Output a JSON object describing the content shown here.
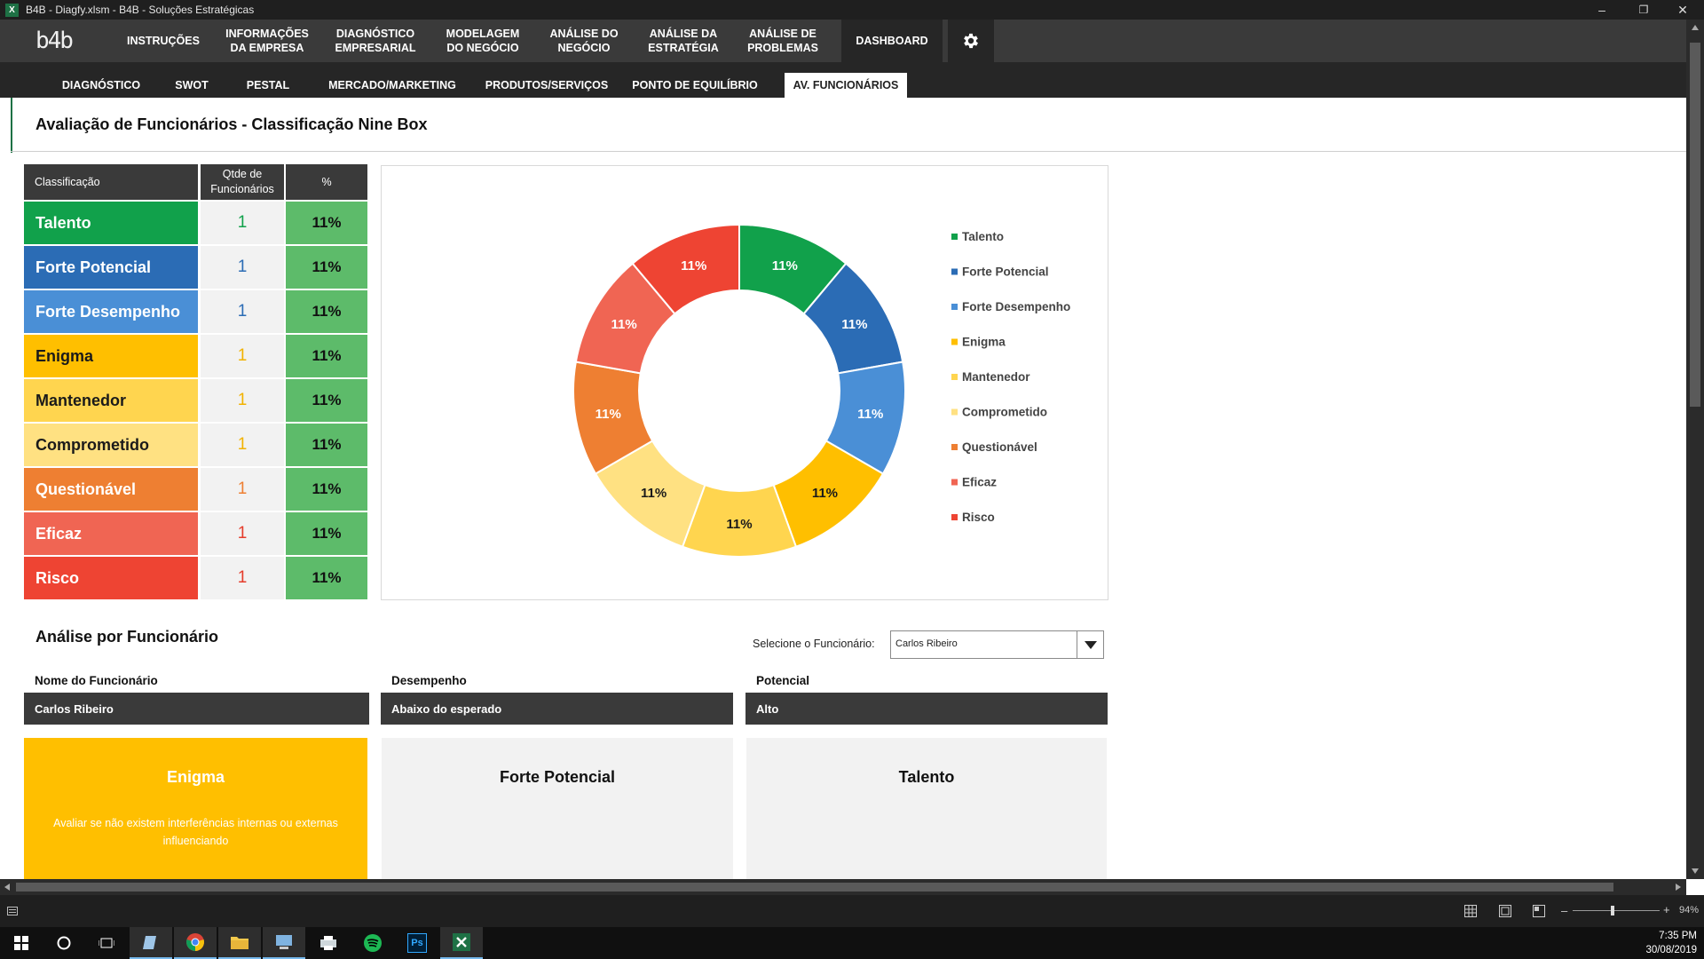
{
  "window": {
    "title": "B4B - Diagfy.xlsm - B4B - Soluções Estratégicas",
    "app_icon": "X"
  },
  "nav": {
    "logo": "b4b",
    "items": [
      {
        "label": "INSTRUÇÕES"
      },
      {
        "label": "INFORMAÇÕES\nDA EMPRESA"
      },
      {
        "label": "DIAGNÓSTICO\nEMPRESARIAL"
      },
      {
        "label": "MODELAGEM\nDO NEGÓCIO"
      },
      {
        "label": "ANÁLISE DO\nNEGÓCIO"
      },
      {
        "label": "ANÁLISE DA\nESTRATÉGIA"
      },
      {
        "label": "ANÁLISE DE\nPROBLEMAS"
      },
      {
        "label": "DASHBOARD"
      }
    ]
  },
  "subnav": {
    "items": [
      {
        "label": "DIAGNÓSTICO"
      },
      {
        "label": "SWOT"
      },
      {
        "label": "PESTAL"
      },
      {
        "label": "MERCADO/MARKETING"
      },
      {
        "label": "PRODUTOS/SERVIÇOS"
      },
      {
        "label": "PONTO DE EQUILÍBRIO"
      },
      {
        "label": "AV. FUNCIONÁRIOS"
      }
    ]
  },
  "page_title": "Avaliação de Funcionários - Classificação Nine Box",
  "table": {
    "headers": {
      "classification": "Classificação",
      "qty": "Qtde de\nFuncionários",
      "pct": "%"
    },
    "rows": [
      {
        "name": "Talento",
        "qty": "1",
        "pct": "11%",
        "color": "#11a14b",
        "qty_color": "#11a14b",
        "text_color": "#ffffff"
      },
      {
        "name": "Forte Potencial",
        "qty": "1",
        "pct": "11%",
        "color": "#2b6cb5",
        "qty_color": "#2b6cb5",
        "text_color": "#ffffff"
      },
      {
        "name": "Forte Desempenho",
        "qty": "1",
        "pct": "11%",
        "color": "#4a8fd6",
        "qty_color": "#2b6cb5",
        "text_color": "#ffffff"
      },
      {
        "name": "Enigma",
        "qty": "1",
        "pct": "11%",
        "color": "#ffbf00",
        "qty_color": "#f2b200",
        "text_color": "#1a1a1a"
      },
      {
        "name": "Mantenedor",
        "qty": "1",
        "pct": "11%",
        "color": "#ffd54f",
        "qty_color": "#f2b200",
        "text_color": "#1a1a1a"
      },
      {
        "name": "Comprometido",
        "qty": "1",
        "pct": "11%",
        "color": "#ffe182",
        "qty_color": "#f2b200",
        "text_color": "#1a1a1a"
      },
      {
        "name": "Questionável",
        "qty": "1",
        "pct": "11%",
        "color": "#ee7f32",
        "qty_color": "#ee7f32",
        "text_color": "#ffffff"
      },
      {
        "name": "Eficaz",
        "qty": "1",
        "pct": "11%",
        "color": "#f06553",
        "qty_color": "#e53c2b",
        "text_color": "#ffffff"
      },
      {
        "name": "Risco",
        "qty": "1",
        "pct": "11%",
        "color": "#ee4433",
        "qty_color": "#e53c2b",
        "text_color": "#ffffff"
      }
    ]
  },
  "chart_data": {
    "type": "pie",
    "donut": true,
    "categories": [
      "Talento",
      "Forte Potencial",
      "Forte Desempenho",
      "Enigma",
      "Mantenedor",
      "Comprometido",
      "Questionável",
      "Eficaz",
      "Risco"
    ],
    "values": [
      1,
      1,
      1,
      1,
      1,
      1,
      1,
      1,
      1
    ],
    "data_labels": [
      "11%",
      "11%",
      "11%",
      "11%",
      "11%",
      "11%",
      "11%",
      "11%",
      "11%"
    ],
    "colors": [
      "#11a14b",
      "#2b6cb5",
      "#4a8fd6",
      "#ffbf00",
      "#ffd54f",
      "#ffe182",
      "#ee7f32",
      "#f06553",
      "#ee4433"
    ],
    "label_colors": [
      "#ffffff",
      "#ffffff",
      "#ffffff",
      "#1a1a1a",
      "#1a1a1a",
      "#1a1a1a",
      "#ffffff",
      "#ffffff",
      "#ffffff"
    ],
    "legend": "right",
    "title": ""
  },
  "analysis": {
    "title": "Análise por Funcionário",
    "select_label": "Selecione o Funcionário:",
    "selected_employee": "Carlos Ribeiro",
    "fields": [
      {
        "label": "Nome do Funcionário",
        "value": "Carlos Ribeiro"
      },
      {
        "label": "Desempenho",
        "value": "Abaixo do esperado"
      },
      {
        "label": "Potencial",
        "value": "Alto"
      }
    ],
    "cards": [
      {
        "title": "Enigma",
        "desc": "Avaliar se não existem interferências internas ou externas influenciando",
        "bg": "#ffbf00",
        "fg": "#ffffff"
      },
      {
        "title": "Forte Potencial",
        "desc": "",
        "bg": "#f2f2f2",
        "fg": "#111111"
      },
      {
        "title": "Talento",
        "desc": "",
        "bg": "#f2f2f2",
        "fg": "#111111"
      }
    ]
  },
  "statusbar": {
    "zoom": "94%"
  },
  "taskbar": {
    "icons": [
      "windows-start-icon",
      "search-circle-icon",
      "task-view-icon",
      "notes-icon",
      "chrome-icon",
      "folder-icon",
      "computer-icon",
      "printer-icon",
      "spotify-icon",
      "photoshop-icon",
      "excel-icon"
    ],
    "photoshop_label": "Ps",
    "time": "7:35 PM",
    "date": "30/08/2019"
  }
}
